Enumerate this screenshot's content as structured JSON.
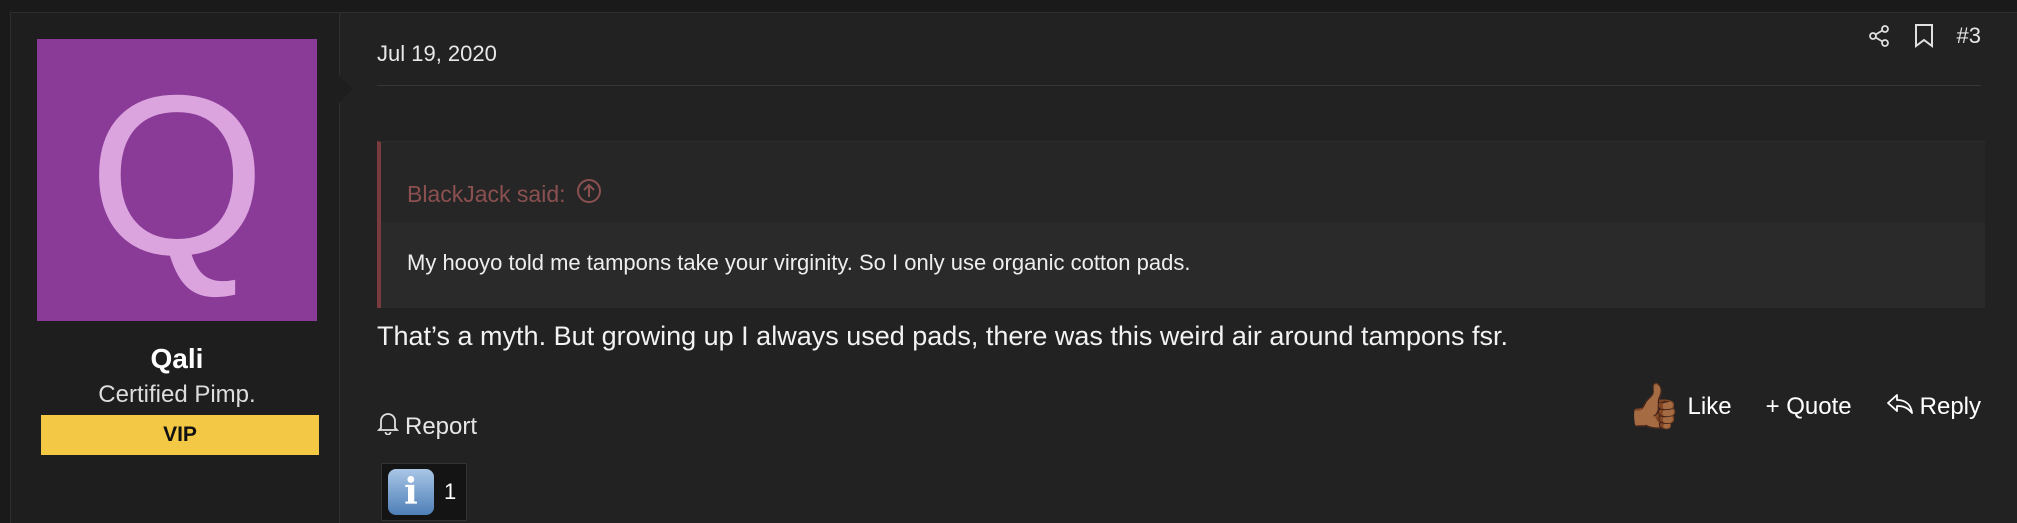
{
  "user": {
    "avatar_letter": "Q",
    "avatar_color": "#8a3b97",
    "avatar_letter_color": "#dba4df",
    "name": "Qali",
    "title": "Certified Pimp.",
    "banner": "VIP",
    "banner_color": "#f3c845"
  },
  "post": {
    "date": "Jul 19, 2020",
    "number": "#3",
    "header_icons": [
      "share-icon",
      "bookmark-icon"
    ],
    "quote": {
      "author_label": "BlackJack said:",
      "expand_icon": "arrow-up-circle-icon",
      "text": "My hooyo told me tampons take your virginity. So I only use organic cotton pads."
    },
    "message": "That’s a myth. But growing up I always used pads, there was this weird air around tampons fsr.",
    "report_label": "Report",
    "actions": {
      "like_icon": "👍🏾",
      "like_label": "Like",
      "quote_label": "+ Quote",
      "reply_label": "Reply"
    },
    "reactions": {
      "icon": "i",
      "count": "1"
    }
  }
}
